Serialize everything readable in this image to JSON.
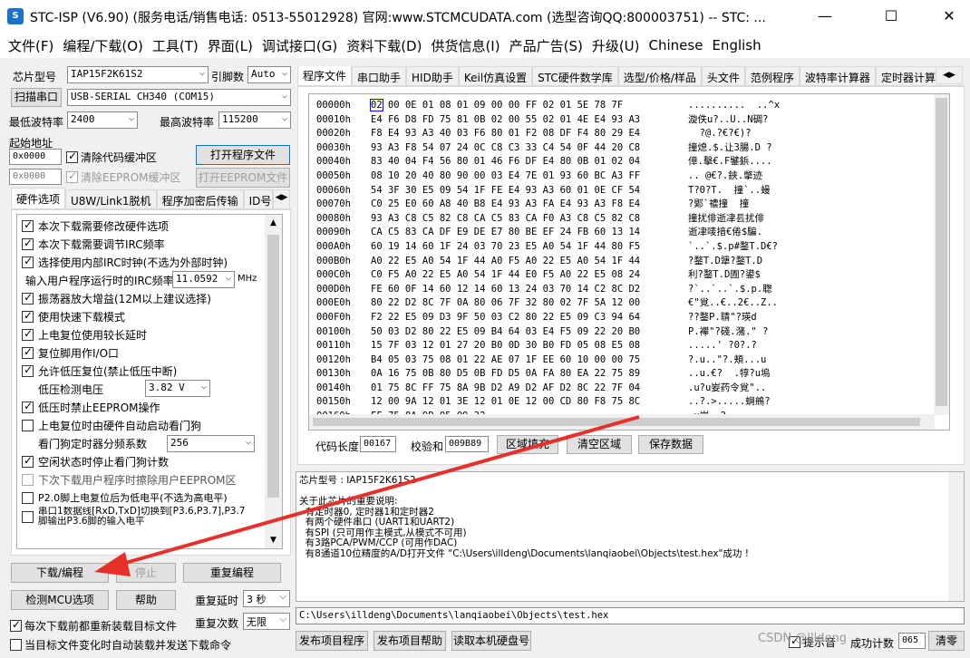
{
  "window": {
    "title": "STC-ISP (V6.90) (服务电话/销售电话: 0513-55012928) 官网:www.STCMCUDATA.com  (选型咨询QQ:800003751) -- STC: ..."
  },
  "menu": [
    "文件(F)",
    "编程/下载(O)",
    "工具(T)",
    "界面(L)",
    "调试接口(G)",
    "资料下载(D)",
    "供货信息(I)",
    "产品广告(S)",
    "升级(U)",
    "Chinese",
    "English"
  ],
  "left": {
    "chip_label": "芯片型号",
    "chip_value": "IAP15F2K61S2",
    "pin_label": "引脚数",
    "pin_value": "Auto",
    "scan_label": "扫描串口",
    "port_value": "USB-SERIAL CH340 (COM15)",
    "min_baud_label": "最低波特率",
    "min_baud": "2400",
    "max_baud_label": "最高波特率",
    "max_baud": "115200",
    "start_addr_label": "起始地址",
    "addr1": "0x0000",
    "clear_code": "清除代码缓冲区",
    "open_prog": "打开程序文件",
    "addr2": "0x0000",
    "clear_eeprom": "清除EEPROM缓冲区",
    "open_eeprom": "打开EEPROM文件",
    "tabs": [
      "硬件选项",
      "U8W/Link1脱机",
      "程序加密后传输",
      "ID号"
    ],
    "options": {
      "o1": "本次下载需要修改硬件选项",
      "o2": "本次下载需要调节IRC频率",
      "o3": "选择使用内部IRC时钟(不选为外部时钟)",
      "irc_label": "输入用户程序运行时的IRC频率",
      "irc_value": "11.0592",
      "irc_unit": "MHz",
      "o4": "振荡器放大增益(12M以上建议选择)",
      "o5": "使用快速下载模式",
      "o6": "上电复位使用较长延时",
      "o7": "复位脚用作I/O口",
      "o8": "允许低压复位(禁止低压中断)",
      "lv_label": "低压检测电压",
      "lv_value": "3.82 V",
      "o9": "低压时禁止EEPROM操作",
      "o10": "上电复位时由硬件自动启动看门狗",
      "wdt_label": "看门狗定时器分频系数",
      "wdt_value": "256",
      "o11": "空闲状态时停止看门狗计数",
      "o12": "下次下载用户程序时擦除用户EEPROM区",
      "o13": "P2.0脚上电复位后为低电平(不选为高电平)",
      "o14": "串口1数据线[RxD,TxD]切换到[P3.6,P3.7],P3.7脚输出P3.6脚的输入电平"
    },
    "download_btn": "下载/编程",
    "stop_btn": "停止",
    "reprogram_btn": "重复编程",
    "detect_btn": "检测MCU选项",
    "help_btn": "帮助",
    "repeat_delay_label": "重复延时",
    "repeat_delay": "3 秒",
    "repeat_count_label": "重复次数",
    "repeat_count": "无限",
    "reload_chk": "每次下载前都重新装载目标文件",
    "auto_chk": "当目标文件变化时自动装载并发送下载命令"
  },
  "right": {
    "tabs": [
      "程序文件",
      "串口助手",
      "HID助手",
      "Keil仿真设置",
      "STC硬件数学库",
      "选型/价格/样品",
      "头文件",
      "范例程序",
      "波特率计算器",
      "定时器计算"
    ],
    "hex": [
      {
        "a": "00000h",
        "b": "02 00 0E 01 08 01 09 00 00 FF 02 01 5E 78 7F",
        "t": "..........  ..^x"
      },
      {
        "a": "00010h",
        "b": "E4 F6 D8 FD 75 81 0B 02 00 55 02 01 4E E4 93 A3",
        "t": "漩佚u?..U..N碉?"
      },
      {
        "a": "00020h",
        "b": "F8 E4 93 A3 40 03 F6 80 01 F2 08 DF F4 80 29 E4",
        "t": "  ?@.?€?€)?"
      },
      {
        "a": "00030h",
        "b": "93 A3 F8 54 07 24 0C C8 C3 33 C4 54 0F 44 20 C8",
        "t": "撞熄.$.让3腸.D ?"
      },
      {
        "a": "00040h",
        "b": "83 40 04 F4 56 80 01 46 F6 DF E4 80 0B 01 02 04",
        "t": "傽.擊€.F鐾鋲...."
      },
      {
        "a": "00050h",
        "b": "08 10 20 40 80 90 00 03 E4 7E 01 93 60 BC A3 FF",
        "t": ".. @€?.鋏.撆迹"
      },
      {
        "a": "00060h",
        "b": "54 3F 30 E5 09 54 1F FE E4 93 A3 60 01 0E CF 54",
        "t": "T?0?T.  撞`..蟃"
      },
      {
        "a": "00070h",
        "b": "C0 25 E0 60 A8 40 B8 E4 93 A3 FA E4 93 A3 F8 E4",
        "t": "?郹`禯撞  撞"
      },
      {
        "a": "00080h",
        "b": "93 A3 C8 C5 82 C8 CA C5 83 CA F0 A3 C8 C5 82 C8",
        "t": "撞扰俳逝冿镸扰俳"
      },
      {
        "a": "00090h",
        "b": "CA C5 83 CA DF E9 DE E7 80 BE EF 24 FB 60 13 14",
        "t": "逝冿唛揞€倦$騙."
      },
      {
        "a": "000A0h",
        "b": "60 19 14 60 1F 24 03 70 23 E5 A0 54 1F 44 80 F5",
        "t": "`..`.$.p#鍪T.D€?"
      },
      {
        "a": "000B0h",
        "b": "A0 22 E5 A0 54 1F 44 A0 F5 A0 22 E5 A0 54 1F 44",
        "t": "?鍪T.D犟?鍪T.D"
      },
      {
        "a": "000C0h",
        "b": "C0 F5 A0 22 E5 A0 54 1F 44 E0 F5 A0 22 E5 08 24",
        "t": "利?鍪T.D圊?鍙$"
      },
      {
        "a": "000D0h",
        "b": "FE 60 0F 14 60 12 14 60 13 24 03 70 14 C2 8C D2",
        "t": "?`..`..`.$.p.聦"
      },
      {
        "a": "000E0h",
        "b": "80 22 D2 8C 7F 0A 80 06 7F 32 80 02 7F 5A 12 00",
        "t": "€\"覍..€..2€..Z.."
      },
      {
        "a": "000F0h",
        "b": "F2 22 E5 09 D3 9F 50 03 C2 80 22 E5 09 C3 94 64",
        "t": "??鍪P.聙\"?瑛d"
      },
      {
        "a": "00100h",
        "b": "50 03 D2 80 22 E5 09 B4 64 03 E4 F5 09 22 20 B0",
        "t": "P.襻\"?碊.潴.\" ?"
      },
      {
        "a": "00110h",
        "b": "15 7F 03 12 01 27 20 B0 0D 30 B0 FD 05 08 E5 08",
        "t": ".....' ?0?.?"
      },
      {
        "a": "00120h",
        "b": "B4 05 03 75 08 01 22 AE 07 1F EE 60 10 00 00 75",
        "t": "?.u..\"?.頬...u"
      },
      {
        "a": "00130h",
        "b": "0A 16 75 0B 80 D5 0B FD D5 0A FA 80 EA 22 75 89",
        "t": "..u.€?  .犉?u塢"
      },
      {
        "a": "00140h",
        "b": "01 75 8C FF 75 8A 9B D2 A9 D2 AF D2 8C 22 7F 04",
        "t": ".u?u妛药令覍\".."
      },
      {
        "a": "00150h",
        "b": "12 00 9A 12 01 3E 12 01 0E 12 00 CD 80 F8 75 8C",
        "t": "..?.>.....蛧鴘?"
      },
      {
        "a": "00160h",
        "b": "FF 75 8A 9B 05 09 32",
        "t": " u妛..2"
      }
    ],
    "code_len_label": "代码长度",
    "code_len": "00167",
    "checksum_label": "校验和",
    "checksum": "009B89",
    "fill_btn": "区域填充",
    "clear_btn": "清空区域",
    "save_btn": "保存数据",
    "log": [
      "芯片型号 : IAP15F2K61S2",
      "",
      "关于此芯片的重要说明:",
      "  有定时器0, 定时器1和定时器2",
      "  有两个硬件串口 (UART1和UART2)",
      "  有SPI (只可用作主模式,从模式不可用)",
      "  有3路PCA/PWM/CCP (可用作DAC)",
      "  有8通道10位精度的A/D打开文件 \"C:\\Users\\illdeng\\Documents\\lanqiaobei\\Objects\\test.hex\"成功 !"
    ],
    "path": "C:\\Users\\illdeng\\Documents\\lanqiaobei\\Objects\\test.hex",
    "publish_prog": "发布项目程序",
    "publish_help": "发布项目帮助",
    "read_disk": "读取本机硬盘号",
    "hint_chk": "提示音",
    "success_label": "成功计数",
    "success_count": "065",
    "clear_count": "清零",
    "watermark": "CSDN @Illdeng"
  }
}
